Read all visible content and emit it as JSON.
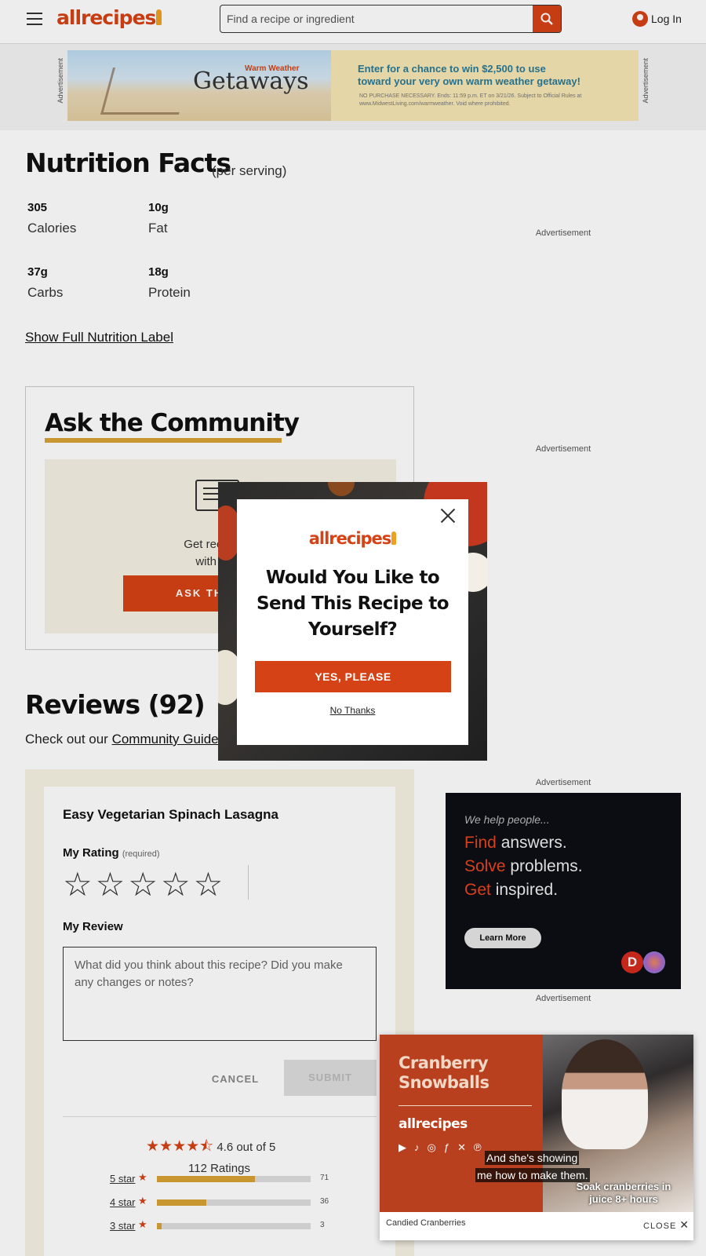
{
  "header": {
    "logo_text": "allrecipes",
    "search_placeholder": "Find a recipe or ingredient",
    "login_label": "Log In"
  },
  "top_ad": {
    "side_label": "Advertisement",
    "tagline": "Warm Weather",
    "headline": "Getaways",
    "promo_line1": "Enter for a chance to win $2,500 to use",
    "promo_line2": "toward your very own warm weather getaway!",
    "fine_print": "NO PURCHASE NECESSARY. Ends: 11:59 p.m. ET on 3/21/26. Subject to Official Rules at www.MidwestLiving.com/warmweather. Void where prohibited."
  },
  "nutrition": {
    "title": "Nutrition Facts",
    "subtitle": "(per serving)",
    "items": [
      {
        "value": "305",
        "label": "Calories"
      },
      {
        "value": "10g",
        "label": "Fat"
      },
      {
        "value": "37g",
        "label": "Carbs"
      },
      {
        "value": "18g",
        "label": "Protein"
      }
    ],
    "show_full_label": "Show Full Nutrition Label"
  },
  "advertisement_label": "Advertisement",
  "ask_community": {
    "title": "Ask the Community",
    "text_line1": "Get recipe hel",
    "text_line2": "with the c",
    "button_label": "ASK THE FIRS"
  },
  "reviews": {
    "title": "Reviews (92)",
    "sub_prefix": "Check out our ",
    "sub_link": "Community Guide",
    "recipe_name": "Easy Vegetarian Spinach Lasagna",
    "my_rating_label": "My Rating",
    "required_label": "(required)",
    "my_review_label": "My Review",
    "review_placeholder": "What did you think about this recipe? Did you make any changes or notes?",
    "cancel_label": "CANCEL",
    "submit_label": "SUBMIT",
    "average_text": "4.6 out of 5",
    "ratings_count": "112 Ratings",
    "distribution": [
      {
        "label": "5 star",
        "count": "71",
        "fraction": 0.64
      },
      {
        "label": "4 star",
        "count": "36",
        "fraction": 0.32
      },
      {
        "label": "3 star",
        "count": "3",
        "fraction": 0.03
      }
    ]
  },
  "side_ad": {
    "intro": "We help people...",
    "line1_accent": "Find",
    "line1_rest": " answers.",
    "line2_accent": "Solve",
    "line2_rest": " problems.",
    "line3_accent": "Get",
    "line3_rest": " inspired.",
    "button_label": "Learn More",
    "logo_letter": "D"
  },
  "video": {
    "title_line1": "Cranberry",
    "title_line2": "Snowballs",
    "brand": "allrecipes",
    "caption_line1": "And she's showing",
    "caption_line2": "me how to make them.",
    "overlay_text": "Soak cranberries in juice 8+ hours",
    "footer_title": "Candied Cranberries",
    "close_label": "CLOSE"
  },
  "modal": {
    "logo_text": "allrecipes",
    "title": "Would You Like to Send This Recipe to Yourself?",
    "yes_label": "YES, PLEASE",
    "no_label": "No Thanks"
  },
  "colors": {
    "brand": "#d54215",
    "accent_gold": "#d8a336",
    "spoon": "#f0a01e"
  }
}
